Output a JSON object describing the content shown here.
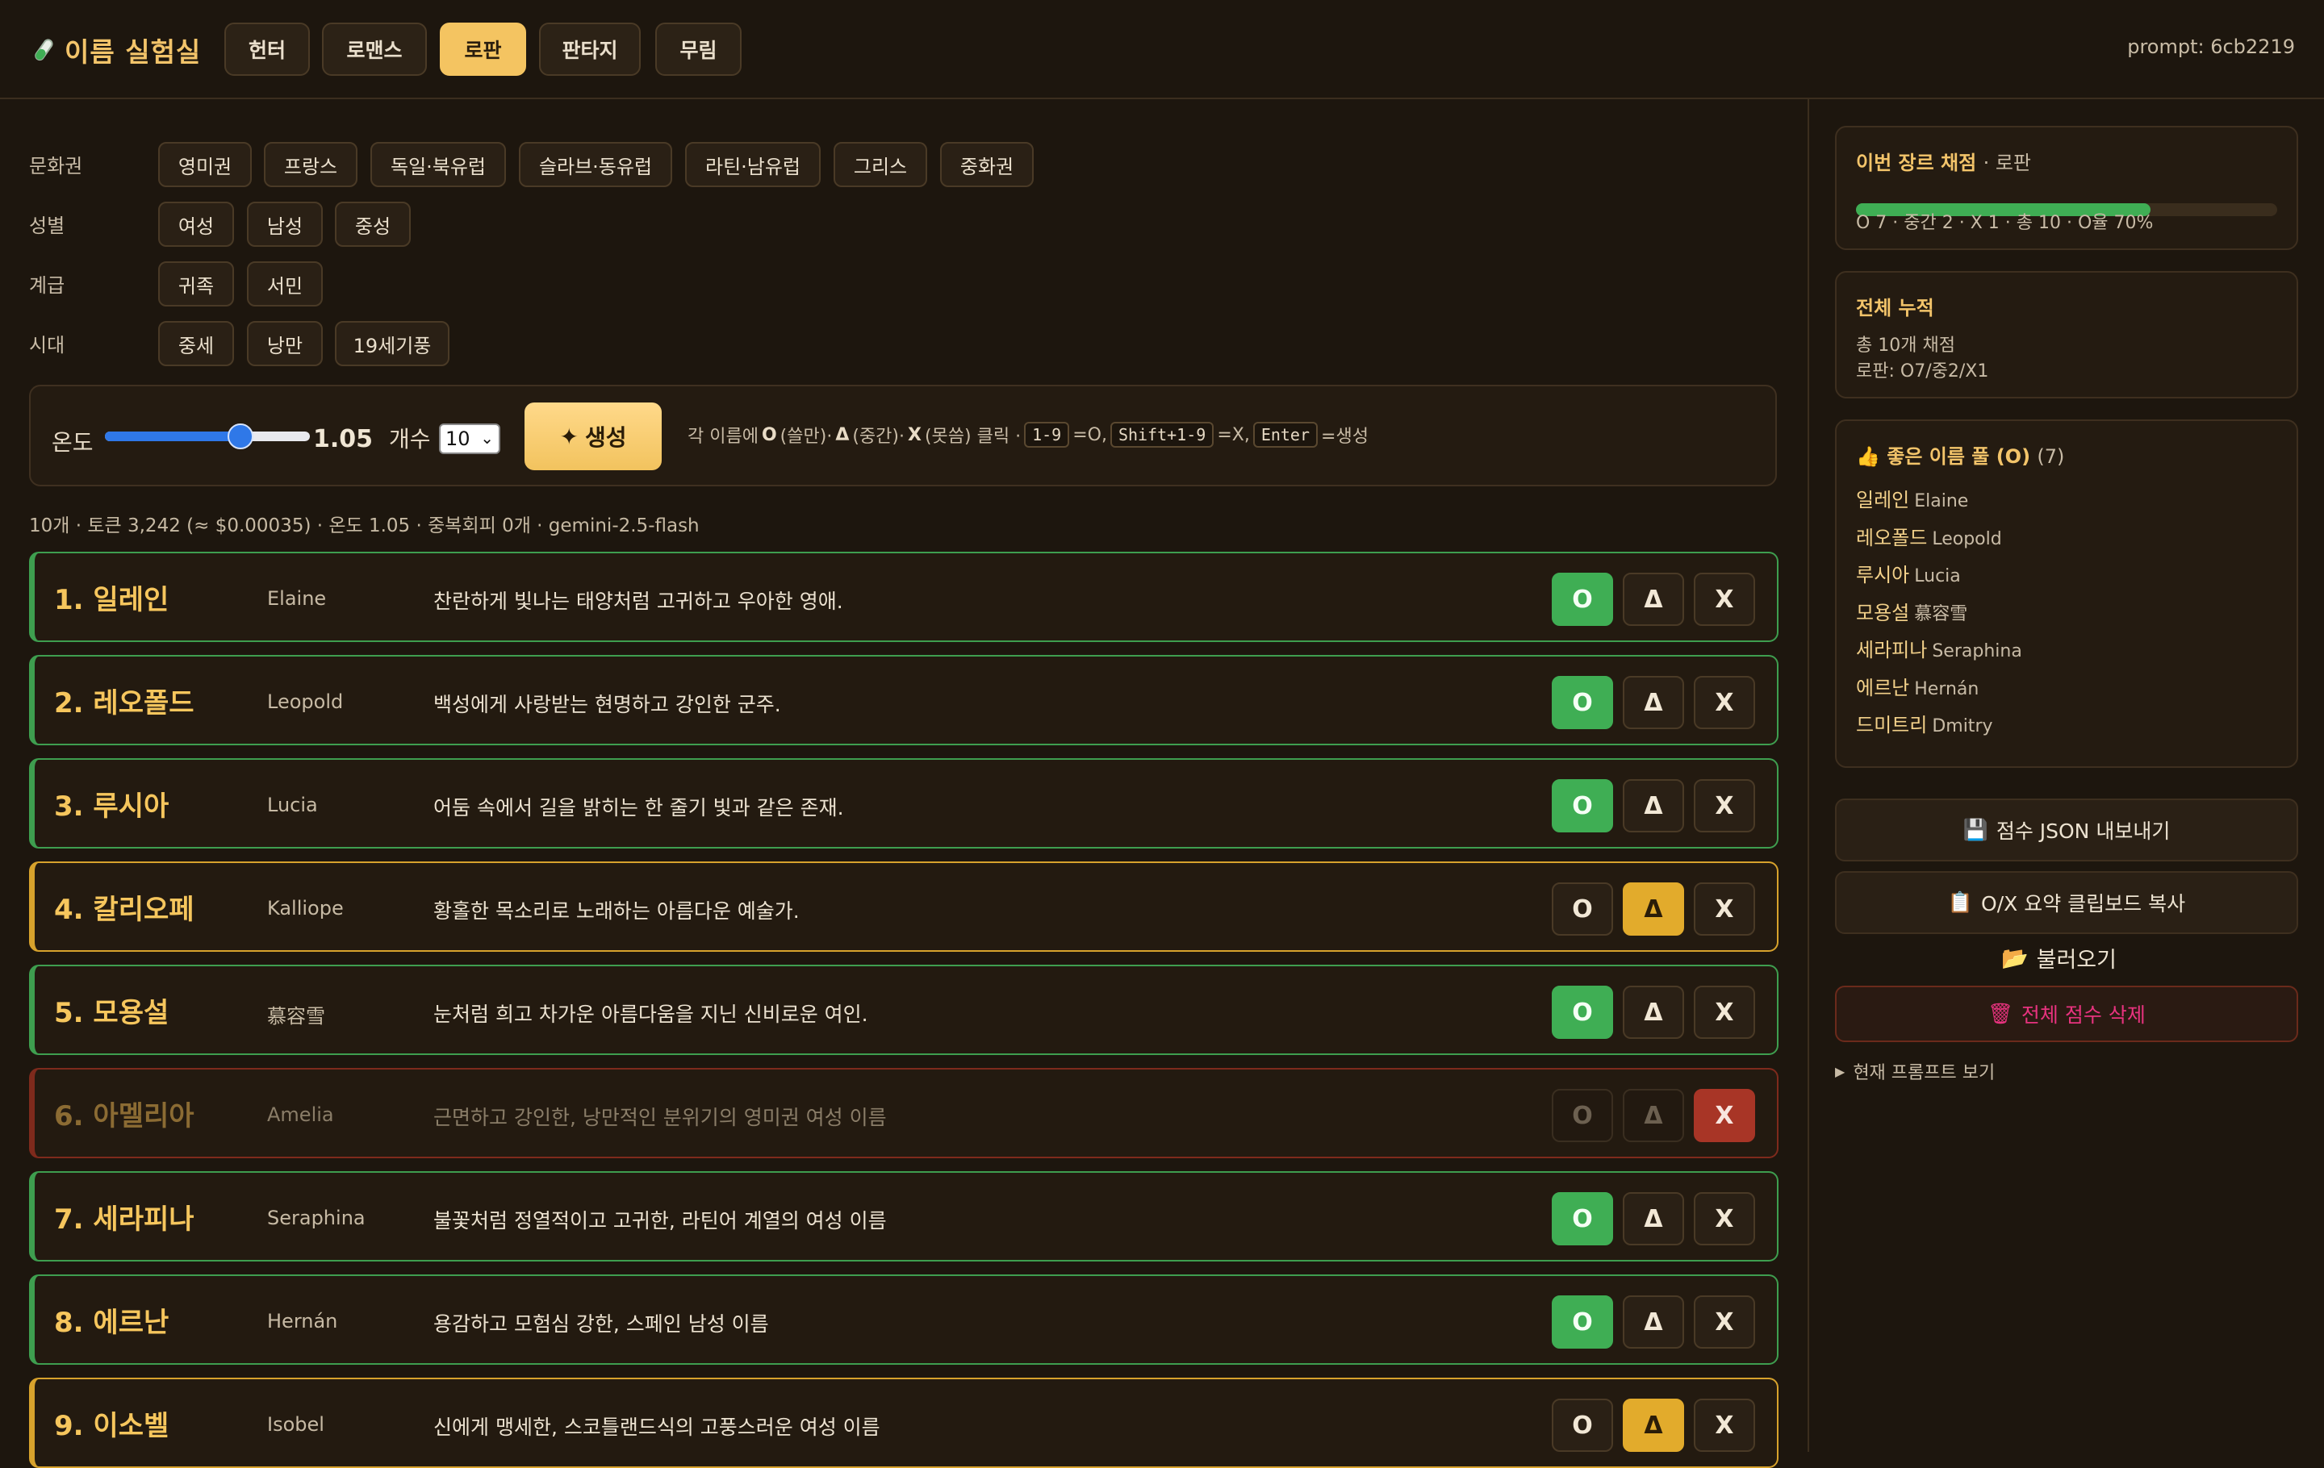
{
  "app": {
    "title": "이름 실험실",
    "prompt_id": "prompt: 6cb2219"
  },
  "genres": [
    {
      "label": "헌터",
      "active": false
    },
    {
      "label": "로맨스",
      "active": false
    },
    {
      "label": "로판",
      "active": true
    },
    {
      "label": "판타지",
      "active": false
    },
    {
      "label": "무림",
      "active": false
    }
  ],
  "filters": {
    "culture": {
      "label": "문화권",
      "options": [
        "영미권",
        "프랑스",
        "독일·북유럽",
        "슬라브·동유럽",
        "라틴·남유럽",
        "그리스",
        "중화권"
      ]
    },
    "gender": {
      "label": "성별",
      "options": [
        "여성",
        "남성",
        "중성"
      ]
    },
    "class": {
      "label": "계급",
      "options": [
        "귀족",
        "서민"
      ]
    },
    "era": {
      "label": "시대",
      "options": [
        "중세",
        "낭만",
        "19세기풍"
      ]
    }
  },
  "controls": {
    "temp_label": "온도",
    "temp_value": "1.05",
    "temp_fraction": 0.66,
    "count_label": "개수",
    "count_value": "10",
    "generate_label": "생성",
    "hint": {
      "prefix": "각 이름에",
      "o_mark": "O",
      "o_text": "(쓸만)·",
      "m_mark": "Δ",
      "m_text": "(중간)·",
      "x_mark": "X",
      "x_text": "(못씀) 클릭 ·",
      "key1": "1-9",
      "eq1": "=O,",
      "key2": "Shift+1-9",
      "eq2": "=X,",
      "key3": "Enter",
      "eq3": "=생성"
    }
  },
  "stats": "10개 · 토큰 3,242 (≈ $0.00035) · 온도 1.05 · 중복회피 0개 · gemini-2.5-flash",
  "names": [
    {
      "num": "1. 일레인",
      "roman": "Elaine",
      "desc": "찬란하게 빛나는 태양처럼 고귀하고 우아한 영애.",
      "score": "O"
    },
    {
      "num": "2. 레오폴드",
      "roman": "Leopold",
      "desc": "백성에게 사랑받는 현명하고 강인한 군주.",
      "score": "O"
    },
    {
      "num": "3. 루시아",
      "roman": "Lucia",
      "desc": "어둠 속에서 길을 밝히는 한 줄기 빛과 같은 존재.",
      "score": "O"
    },
    {
      "num": "4. 칼리오페",
      "roman": "Kalliope",
      "desc": "황홀한 목소리로 노래하는 아름다운 예술가.",
      "score": "Δ"
    },
    {
      "num": "5. 모용설",
      "roman": "慕容雪",
      "desc": "눈처럼 희고 차가운 아름다움을 지닌 신비로운 여인.",
      "score": "O"
    },
    {
      "num": "6. 아멜리아",
      "roman": "Amelia",
      "desc": "근면하고 강인한, 낭만적인 분위기의 영미권 여성 이름",
      "score": "X"
    },
    {
      "num": "7. 세라피나",
      "roman": "Seraphina",
      "desc": "불꽃처럼 정열적이고 고귀한, 라틴어 계열의 여성 이름",
      "score": "O"
    },
    {
      "num": "8. 에르난",
      "roman": "Hernán",
      "desc": "용감하고 모험심 강한, 스페인 남성 이름",
      "score": "O"
    },
    {
      "num": "9. 이소벨",
      "roman": "Isobel",
      "desc": "신에게 맹세한, 스코틀랜드식의 고풍스러운 여성 이름",
      "score": "Δ"
    }
  ],
  "score_labels": {
    "o": "O",
    "m": "Δ",
    "x": "X"
  },
  "sidebar": {
    "genre_score": {
      "title": "이번 장르 채점",
      "genre": "· 로판",
      "summary": "O 7 · 중간 2 · X 1 · 총 10 · O율 70%",
      "o_rate": 0.7
    },
    "total": {
      "title": "전체 누적",
      "line1": "총 10개 채점",
      "line2": "로판: O7/중2/X1"
    },
    "pool": {
      "title": "좋은 이름 풀 (O)",
      "count": "(7)",
      "items": [
        {
          "name": "일레인",
          "roman": "Elaine"
        },
        {
          "name": "레오폴드",
          "roman": "Leopold"
        },
        {
          "name": "루시아",
          "roman": "Lucia"
        },
        {
          "name": "모용설",
          "roman": "慕容雪"
        },
        {
          "name": "세라피나",
          "roman": "Seraphina"
        },
        {
          "name": "에르난",
          "roman": "Hernán"
        },
        {
          "name": "드미트리",
          "roman": "Dmitry"
        }
      ]
    },
    "export_label": "점수 JSON 내보내기",
    "copy_label": "O/X 요약 클립보드 복사",
    "load_label": "불러오기",
    "delete_label": "전체 점수 삭제",
    "prompt_toggle": "현재 프롬프트 보기"
  },
  "colors": {
    "accent": "#f4c461",
    "good": "#3fae54",
    "mid": "#e2ab2c",
    "bad": "#a83526",
    "danger_text": "#e8337f"
  }
}
